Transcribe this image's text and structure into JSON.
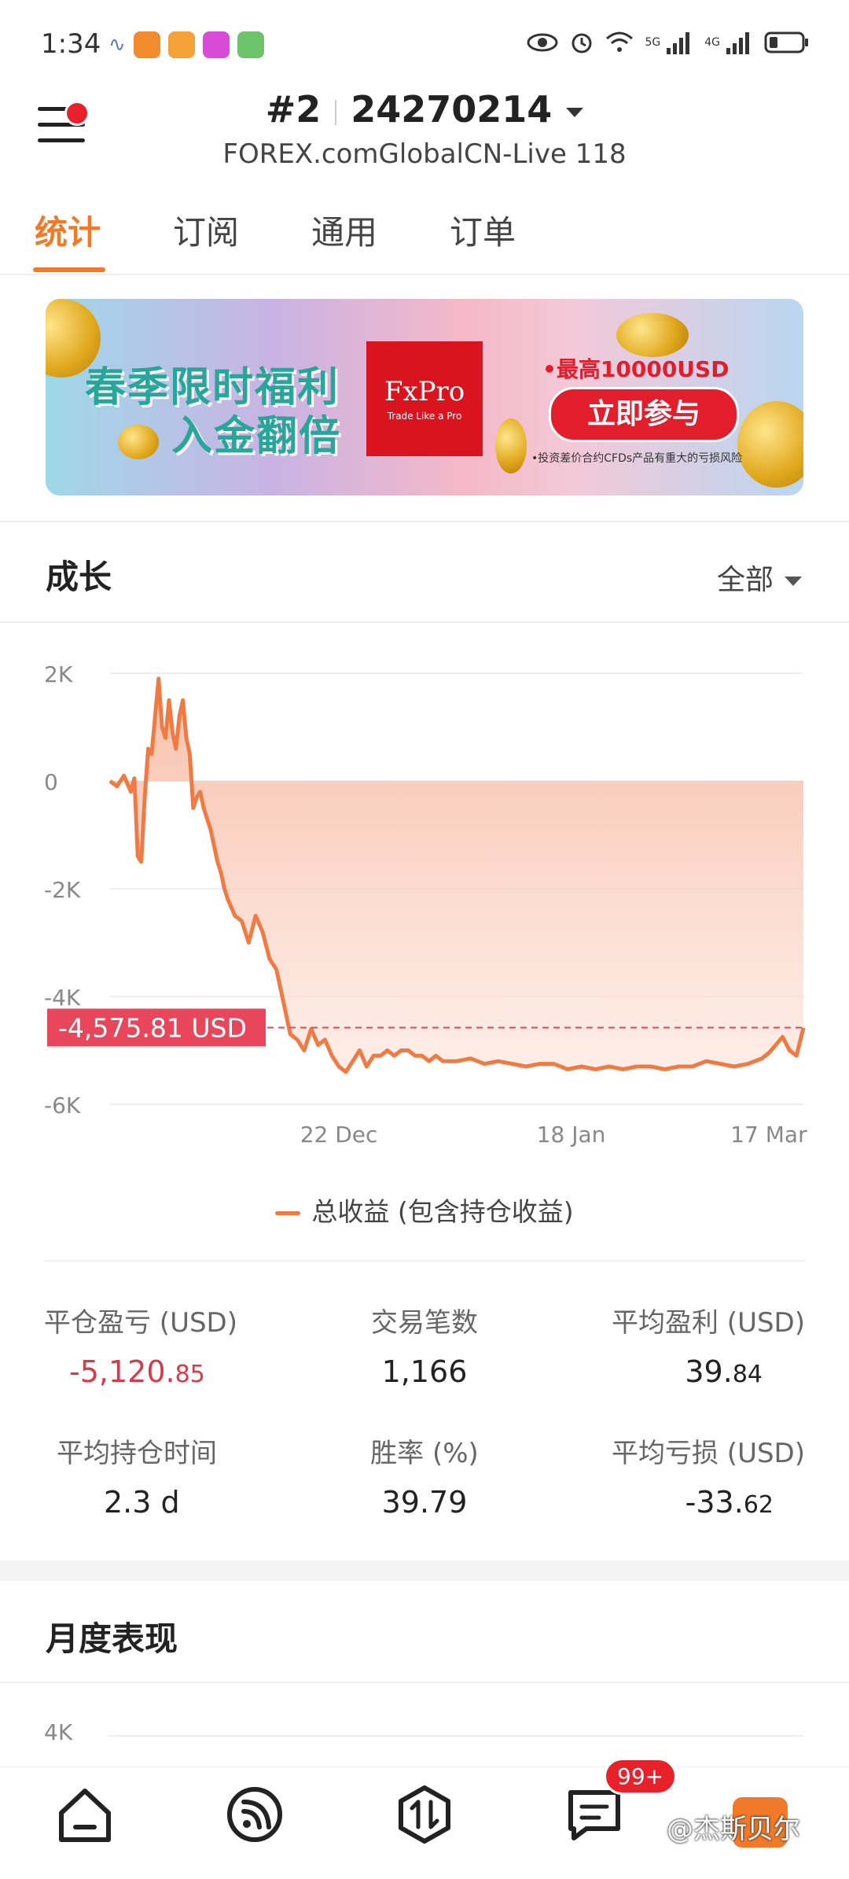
{
  "status_bar": {
    "time": "1:34",
    "net1": "5G",
    "net2": "4G"
  },
  "header": {
    "account_index": "#2",
    "account_number": "24270214",
    "server": "FOREX.comGlobalCN-Live 118"
  },
  "tabs": [
    "统计",
    "订阅",
    "通用",
    "订单"
  ],
  "banner": {
    "line1": "春季限时福利",
    "line2": "入金翻倍",
    "brand": "FxPro",
    "brand_tagline": "Trade Like a Pro",
    "max_text": "•最高10000USD",
    "cta": "立即参与",
    "risk": "•投资差价合约CFDs产品有重大的亏损风险"
  },
  "growth": {
    "title": "成长",
    "filter": "全部",
    "current_value_label": "-4,575.81 USD",
    "legend": "总收益 (包含持仓收益)"
  },
  "chart_data": {
    "type": "area",
    "title": "",
    "ylim": [
      -6000,
      2000
    ],
    "yticks": [
      "2K",
      "0",
      "-2K",
      "-4K",
      "-6K"
    ],
    "ytick_values": [
      2000,
      0,
      -2000,
      -4000,
      -6000
    ],
    "xticks": [
      "22 Dec",
      "18 Jan",
      "17 Mar"
    ],
    "xtick_positions": [
      0.33,
      0.665,
      0.95
    ],
    "current_value": -4575.81,
    "series": [
      {
        "x": [
          0,
          0.01,
          0.02,
          0.03,
          0.035,
          0.04,
          0.045,
          0.05,
          0.055,
          0.06,
          0.065,
          0.07,
          0.075,
          0.08,
          0.085,
          0.09,
          0.095,
          0.1,
          0.105,
          0.11,
          0.115,
          0.12,
          0.125,
          0.13,
          0.135,
          0.14,
          0.145,
          0.15,
          0.155,
          0.16,
          0.165,
          0.17,
          0.18,
          0.19,
          0.2,
          0.21,
          0.22,
          0.23,
          0.24,
          0.25,
          0.26,
          0.27,
          0.28,
          0.29,
          0.3,
          0.31,
          0.32,
          0.33,
          0.34,
          0.35,
          0.36,
          0.37,
          0.38,
          0.39,
          0.4,
          0.41,
          0.42,
          0.43,
          0.44,
          0.45,
          0.46,
          0.47,
          0.48,
          0.5,
          0.52,
          0.54,
          0.56,
          0.58,
          0.6,
          0.62,
          0.64,
          0.66,
          0.68,
          0.7,
          0.72,
          0.74,
          0.76,
          0.78,
          0.8,
          0.82,
          0.84,
          0.86,
          0.88,
          0.9,
          0.92,
          0.94,
          0.95,
          0.96,
          0.97,
          0.98,
          0.99,
          1.0
        ],
        "values": [
          0,
          -100,
          100,
          -200,
          50,
          -1400,
          -1500,
          -300,
          600,
          500,
          1200,
          1900,
          1000,
          800,
          1500,
          900,
          600,
          1200,
          1500,
          800,
          500,
          -500,
          -300,
          -200,
          -500,
          -700,
          -900,
          -1200,
          -1500,
          -1700,
          -2000,
          -2200,
          -2500,
          -2600,
          -3000,
          -2500,
          -2800,
          -3300,
          -3500,
          -4100,
          -4700,
          -4800,
          -5000,
          -4600,
          -4900,
          -4800,
          -5100,
          -5300,
          -5400,
          -5200,
          -5000,
          -5300,
          -5100,
          -5100,
          -5000,
          -5100,
          -5000,
          -5000,
          -5100,
          -5100,
          -5200,
          -5100,
          -5200,
          -5200,
          -5150,
          -5250,
          -5200,
          -5250,
          -5300,
          -5250,
          -5250,
          -5350,
          -5300,
          -5350,
          -5300,
          -5350,
          -5300,
          -5300,
          -5350,
          -5300,
          -5300,
          -5200,
          -5250,
          -5300,
          -5250,
          -5150,
          -5050,
          -4900,
          -4750,
          -5000,
          -5100,
          -4580
        ]
      }
    ]
  },
  "stats": {
    "closed_pnl_label": "平仓盈亏 (USD)",
    "closed_pnl_int": "-5,120.",
    "closed_pnl_dec": "85",
    "trades_label": "交易笔数",
    "trades": "1,166",
    "avg_profit_label": "平均盈利 (USD)",
    "avg_profit_int": "39.",
    "avg_profit_dec": "84",
    "avg_hold_label": "平均持仓时间",
    "avg_hold": "2.3 d",
    "win_rate_label": "胜率 (%)",
    "win_rate": "39.79",
    "avg_loss_label": "平均亏损 (USD)",
    "avg_loss_int": "-33.",
    "avg_loss_dec": "62"
  },
  "monthly": {
    "title": "月度表现",
    "ytick_top": "4K"
  },
  "bottom_nav": {
    "badge": "99+",
    "watermark": "@杰斯贝尔",
    "icons": [
      "home-icon",
      "feed-icon",
      "trade-icon",
      "messages-icon",
      "profile-icon"
    ]
  },
  "colors": {
    "accent": "#f07a2a",
    "line": "#f07a44",
    "negative": "#d83a4a",
    "label_red": "#e8465a"
  }
}
